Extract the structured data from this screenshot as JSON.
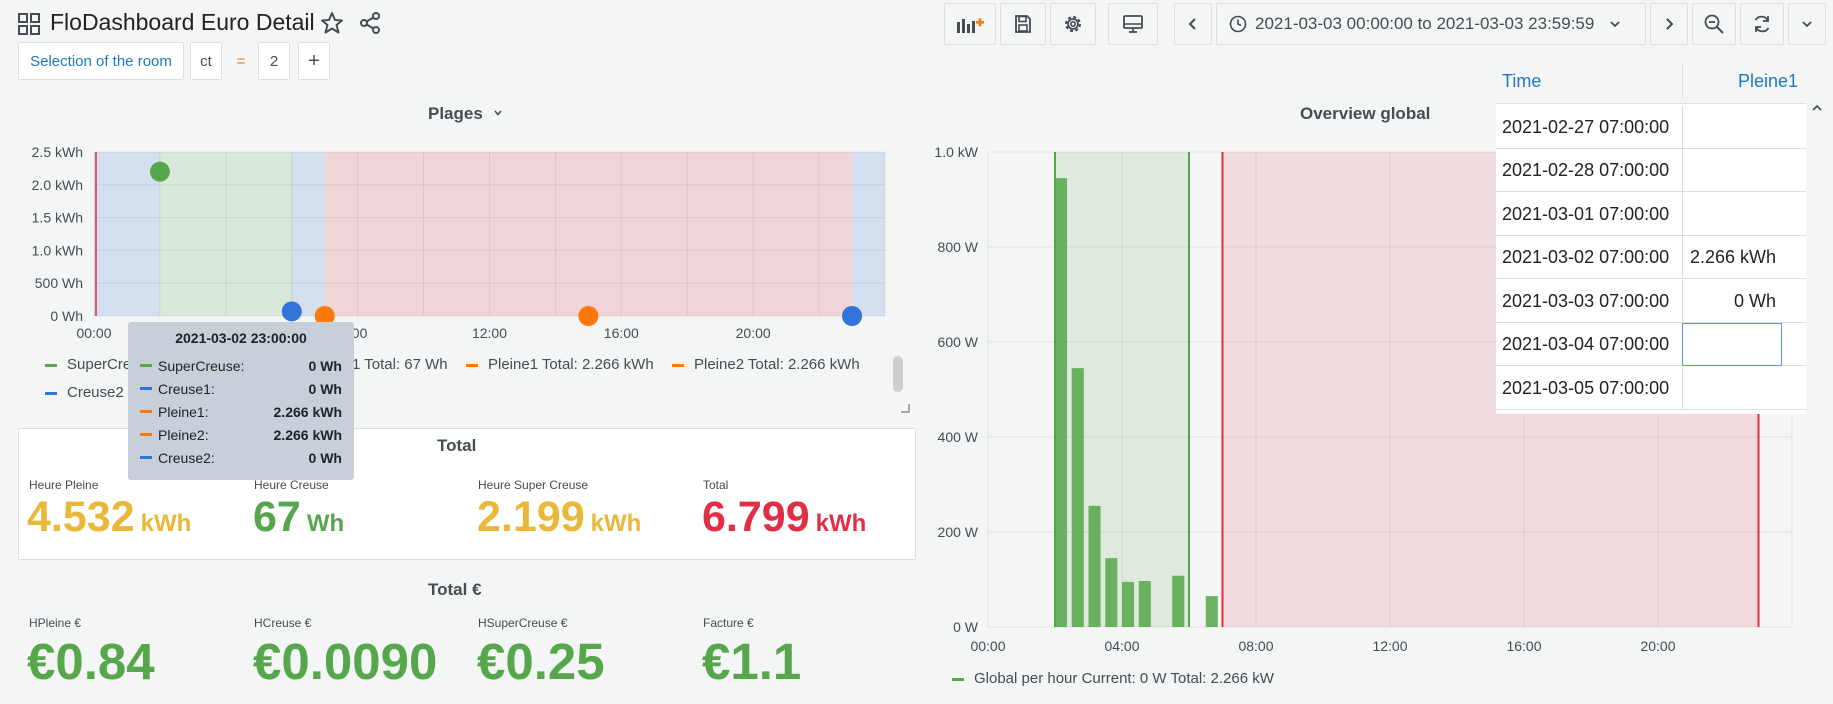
{
  "header": {
    "title": "FloDashboard Euro Detail",
    "time_range": "2021-03-03 00:00:00 to 2021-03-03 23:59:59",
    "icons": [
      "apps-icon",
      "star-icon",
      "share-icon",
      "add-panel-icon",
      "save-icon",
      "settings-icon",
      "tv-mode-icon",
      "clock-icon",
      "chevron-down-icon",
      "chevron-left-icon",
      "chevron-right-icon",
      "zoom-out-icon",
      "refresh-icon",
      "chevron-down-icon"
    ]
  },
  "variables": {
    "label": "Selection of the room",
    "key": "ct",
    "operator": "=",
    "value": "2",
    "add": "+"
  },
  "plages": {
    "title": "Plages",
    "legend": [
      {
        "name": "SuperCreuse",
        "shown": "SuperCre",
        "color": "#56a64b"
      },
      {
        "name": "Creuse1",
        "shown": "1  Total: 67 Wh",
        "color": "#3274d9"
      },
      {
        "name": "Pleine1",
        "shown": "Pleine1  Total: 2.266 kWh",
        "color": "#ff780a"
      },
      {
        "name": "Pleine2",
        "shown": "Pleine2  Total: 2.266 kWh",
        "color": "#ff780a"
      },
      {
        "name": "Creuse2",
        "shown": "Creuse2",
        "color": "#3274d9"
      }
    ],
    "tooltip": {
      "time": "2021-03-02 23:00:00",
      "rows": [
        {
          "name": "SuperCreuse:",
          "value": "0 Wh",
          "color": "#56a64b"
        },
        {
          "name": "Creuse1:",
          "value": "0 Wh",
          "color": "#3274d9"
        },
        {
          "name": "Pleine1:",
          "value": "2.266 kWh",
          "color": "#ff780a"
        },
        {
          "name": "Pleine2:",
          "value": "2.266 kWh",
          "color": "#ff780a"
        },
        {
          "name": "Creuse2:",
          "value": "0 Wh",
          "color": "#3274d9"
        }
      ]
    }
  },
  "chart_data": [
    {
      "type": "scatter",
      "title": "Plages",
      "xlabel": "",
      "ylabel": "",
      "x_ticks": [
        "00:00",
        ":00",
        "12:00",
        "16:00",
        "20:00"
      ],
      "y_ticks": [
        "0 Wh",
        "500 Wh",
        "1.0 kWh",
        "1.5 kWh",
        "2.0 kWh",
        "2.5 kWh"
      ],
      "ylim": [
        0,
        2.5
      ],
      "y_unit": "kWh",
      "grid": true,
      "bands": [
        {
          "from": 0.0,
          "to": 2.0,
          "color": "#3274d9"
        },
        {
          "from": 2.0,
          "to": 6.0,
          "color": "#56a64b"
        },
        {
          "from": 6.0,
          "to": 7.0,
          "color": "#3274d9"
        },
        {
          "from": 7.0,
          "to": 23.0,
          "color": "#e02f44"
        },
        {
          "from": 23.0,
          "to": 24.0,
          "color": "#3274d9"
        }
      ],
      "series": [
        {
          "name": "SuperCreuse",
          "color": "#56a64b",
          "points": [
            {
              "x": 2.0,
              "y": 2.2
            }
          ]
        },
        {
          "name": "Creuse1",
          "color": "#3274d9",
          "points": [
            {
              "x": 6.0,
              "y": 0.07
            }
          ]
        },
        {
          "name": "Pleine1",
          "color": "#ff780a",
          "points": [
            {
              "x": 7.0,
              "y": 0.0
            },
            {
              "x": 15.0,
              "y": 0.0
            }
          ]
        },
        {
          "name": "Creuse2",
          "color": "#3274d9",
          "points": [
            {
              "x": 23.0,
              "y": 0.0
            }
          ]
        }
      ]
    },
    {
      "type": "bar",
      "title": "Overview global",
      "xlabel": "",
      "ylabel": "",
      "x_ticks": [
        "00:00",
        "04:00",
        "08:00",
        "12:00",
        "16:00",
        "20:00"
      ],
      "y_ticks": [
        "0 W",
        "200 W",
        "400 W",
        "600 W",
        "800 W",
        "1.0 kW"
      ],
      "ylim": [
        0,
        1000
      ],
      "y_unit": "W",
      "grid": true,
      "bands": [
        {
          "from": 2.0,
          "to": 6.0,
          "color": "#56a64b"
        },
        {
          "from": 7.0,
          "to": 23.0,
          "color": "#e02f44"
        }
      ],
      "markers": [
        {
          "x": 2.0,
          "color": "#56a64b"
        },
        {
          "x": 6.0,
          "color": "#56a64b"
        },
        {
          "x": 7.0,
          "color": "#e02f44"
        },
        {
          "x": 23.0,
          "color": "#e02f44"
        }
      ],
      "series": [
        {
          "name": "Global per hour",
          "color": "#56a64b",
          "x": [
            2,
            2.5,
            3,
            3.5,
            4,
            4.5,
            5.5,
            6.5
          ],
          "values": [
            945,
            545,
            255,
            145,
            95,
            97,
            108,
            65
          ]
        }
      ],
      "legend": "Global per hour  Current: 0 W  Total: 2.266 kW"
    }
  ],
  "total": {
    "title": "Total",
    "stats": [
      {
        "label": "Heure Pleine",
        "value": "4.532",
        "unit": "kWh",
        "color": "#eab839"
      },
      {
        "label": "Heure Creuse",
        "value": "67",
        "unit": "Wh",
        "color": "#56a64b"
      },
      {
        "label": "Heure Super Creuse",
        "value": "2.199",
        "unit": "kWh",
        "color": "#eab839"
      },
      {
        "label": "Total",
        "value": "6.799",
        "unit": "kWh",
        "color": "#e02f44"
      }
    ]
  },
  "total_euro": {
    "title": "Total €",
    "stats": [
      {
        "label": "HPleine €",
        "value": "€0.84",
        "color": "#56a64b"
      },
      {
        "label": "HCreuse €",
        "value": "€0.0090",
        "color": "#56a64b"
      },
      {
        "label": "HSuperCreuse €",
        "value": "€0.25",
        "color": "#56a64b"
      },
      {
        "label": "Facture €",
        "value": "€1.1",
        "color": "#56a64b"
      }
    ]
  },
  "overview": {
    "title": "Overview global",
    "legend": "Global per hour  Current: 0 W  Total: 2.266 kW"
  },
  "table": {
    "columns": [
      "Time",
      "Pleine1"
    ],
    "rows": [
      {
        "time": "2021-02-27 07:00:00",
        "value": ""
      },
      {
        "time": "2021-02-28 07:00:00",
        "value": ""
      },
      {
        "time": "2021-03-01 07:00:00",
        "value": ""
      },
      {
        "time": "2021-03-02 07:00:00",
        "value": "2.266 kWh"
      },
      {
        "time": "2021-03-03 07:00:00",
        "value": "0 Wh"
      },
      {
        "time": "2021-03-04 07:00:00",
        "value": ""
      },
      {
        "time": "2021-03-05 07:00:00",
        "value": ""
      }
    ]
  }
}
